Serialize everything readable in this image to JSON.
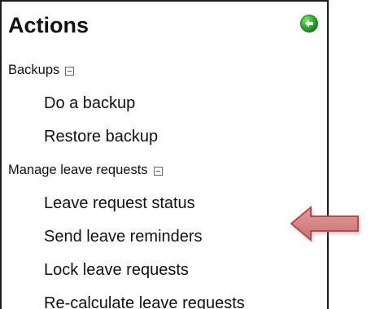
{
  "panel": {
    "title": "Actions",
    "back_icon": "green-back-arrow-icon",
    "colors": {
      "border": "#1d1d1d",
      "text": "#111111",
      "green_icon": "#34b12f",
      "arrow_fill": "#cf8787",
      "arrow_stroke": "#b34d4d"
    }
  },
  "sections": [
    {
      "label": "Backups",
      "expanded": true,
      "items": [
        {
          "label": "Do a backup"
        },
        {
          "label": "Restore backup"
        }
      ]
    },
    {
      "label": "Manage leave requests",
      "expanded": true,
      "items": [
        {
          "label": "Leave request status"
        },
        {
          "label": "Send leave reminders"
        },
        {
          "label": "Lock leave requests"
        },
        {
          "label": "Re-calculate leave requests"
        }
      ]
    }
  ],
  "callout": {
    "icon": "left-arrow-icon"
  }
}
